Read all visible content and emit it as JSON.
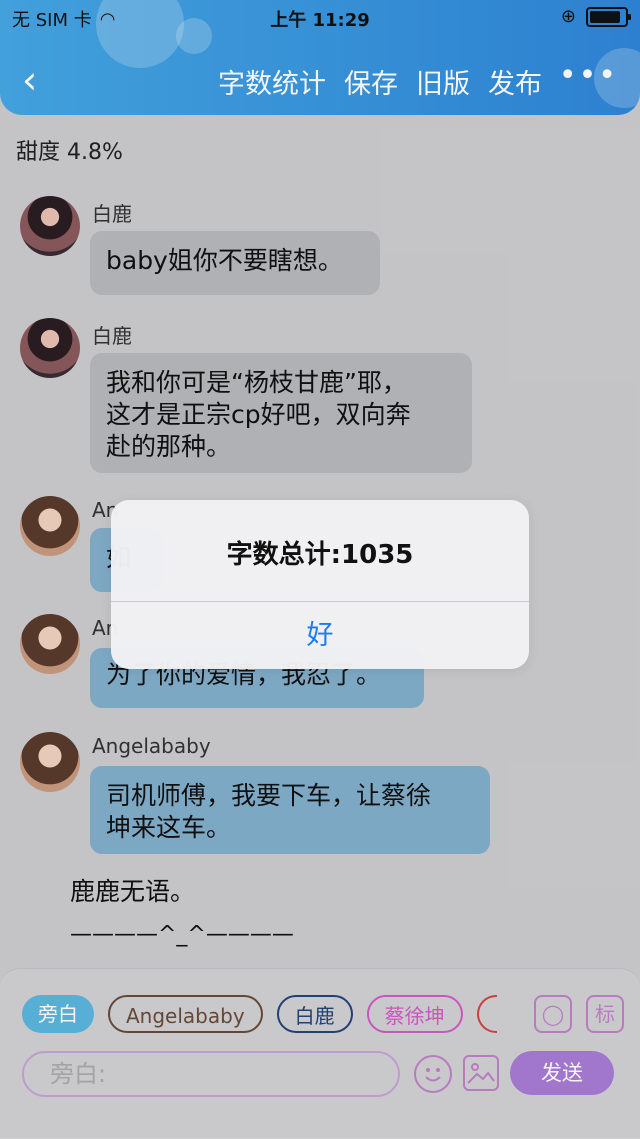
{
  "status_bar": {
    "carrier": "无 SIM 卡",
    "time": "上午 11:29"
  },
  "nav": {
    "back": "‹",
    "actions": [
      "字数统计",
      "保存",
      "旧版",
      "发布"
    ],
    "more": "•••"
  },
  "sweetness": "甜度 4.8%",
  "messages": [
    {
      "sender": "白鹿",
      "text": "baby姐你不要瞎想。"
    },
    {
      "sender": "白鹿",
      "text": "我和你可是“杨枝甘鹿”耶，\n这才是正宗cp好吧，双向奔\n赴的那种。"
    },
    {
      "sender": "An",
      "text": "如"
    },
    {
      "sender": "An",
      "text": "为了你的爱情，我忍了。"
    },
    {
      "sender": "Angelababy",
      "text": "司机师傅，我要下车，让蔡徐\n坤来这车。"
    }
  ],
  "narration": "鹿鹿无语。",
  "divider": "————^_^————",
  "dialog": {
    "title": "字数总计:1035",
    "ok": "好"
  },
  "composer": {
    "chips": [
      "旁白",
      "Angelababy",
      "白鹿",
      "蔡徐坤"
    ],
    "mark_label": "标",
    "input_placeholder": "旁白:",
    "send": "发送"
  }
}
